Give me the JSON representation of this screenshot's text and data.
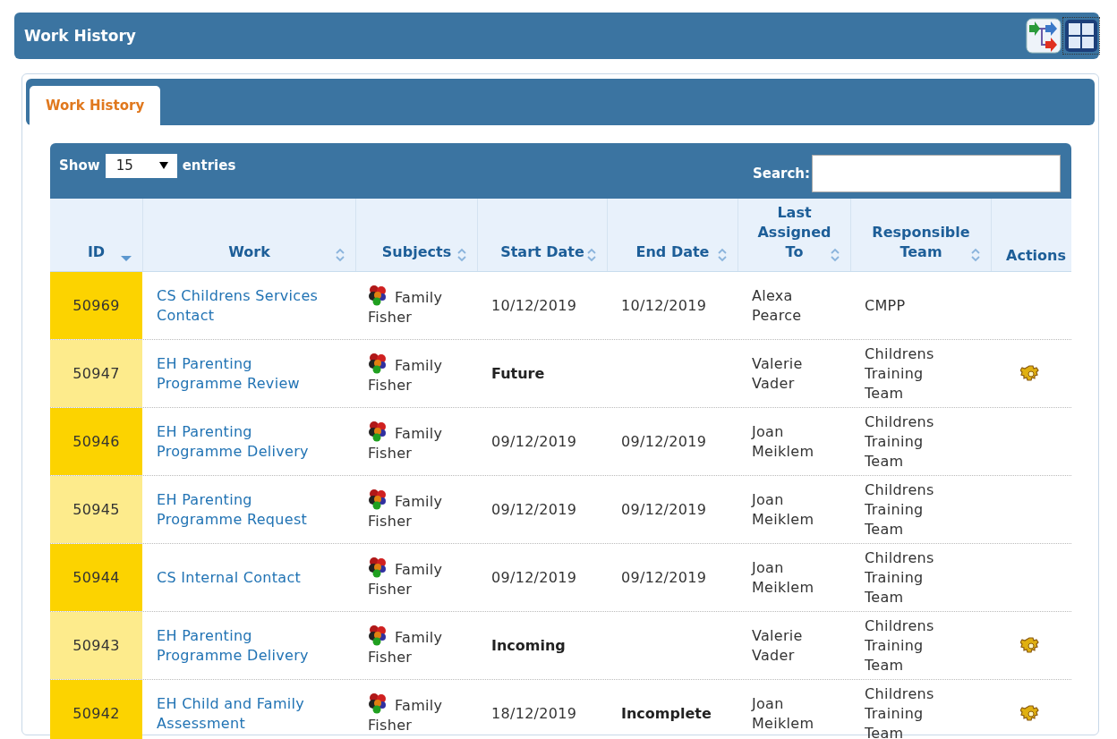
{
  "panel": {
    "title": "Work History"
  },
  "tabs": [
    {
      "label": "Work History",
      "selected": true
    }
  ],
  "table": {
    "length_label_before": "Show",
    "length_value": "15",
    "length_label_after": "entries",
    "search_label": "Search:",
    "columns": [
      {
        "label": "ID",
        "sortable": true,
        "sorted_descending": true
      },
      {
        "label": "Work",
        "sortable": true,
        "sorted_descending": false
      },
      {
        "label": "Subjects",
        "sortable": true,
        "sorted_descending": false
      },
      {
        "label": "Start Date",
        "sortable": true,
        "sorted_descending": false
      },
      {
        "label": "End Date",
        "sortable": true,
        "sorted_descending": false
      },
      {
        "label": "Last Assigned To",
        "sortable": true,
        "sorted_descending": false
      },
      {
        "label": "Responsible Team",
        "sortable": true,
        "sorted_descending": false
      },
      {
        "label": "Actions",
        "sortable": false
      }
    ],
    "rows": [
      {
        "id": "50969",
        "work": "CS Childrens Services Contact",
        "subject": "Family Fisher",
        "start": "10/12/2019",
        "start_bold": false,
        "end": "10/12/2019",
        "end_bold": false,
        "assigned": "Alexa Pearce",
        "team": "CMPP",
        "has_action": false
      },
      {
        "id": "50947",
        "work": "EH Parenting Programme Review",
        "subject": "Family Fisher",
        "start": "Future",
        "start_bold": true,
        "end_bold": false,
        "assigned": "Valerie Vader",
        "team": "Childrens Training Team",
        "has_action": true
      },
      {
        "id": "50946",
        "work": "EH Parenting Programme Delivery",
        "subject": "Family Fisher",
        "start": "09/12/2019",
        "start_bold": false,
        "end": "09/12/2019",
        "end_bold": false,
        "assigned": "Joan Meiklem",
        "team": "Childrens Training Team",
        "has_action": false
      },
      {
        "id": "50945",
        "work": "EH Parenting Programme Request",
        "subject": "Family Fisher",
        "start": "09/12/2019",
        "start_bold": false,
        "end": "09/12/2019",
        "end_bold": false,
        "assigned": "Joan Meiklem",
        "team": "Childrens Training Team",
        "has_action": false
      },
      {
        "id": "50944",
        "work": "CS Internal Contact",
        "subject": "Family Fisher",
        "start": "09/12/2019",
        "start_bold": false,
        "end": "09/12/2019",
        "end_bold": false,
        "assigned": "Joan Meiklem",
        "team": "Childrens Training Team",
        "has_action": false
      },
      {
        "id": "50943",
        "work": "EH Parenting Programme Delivery",
        "subject": "Family Fisher",
        "start": "Incoming",
        "start_bold": true,
        "end_bold": false,
        "assigned": "Valerie Vader",
        "team": "Childrens Training Team",
        "has_action": true
      },
      {
        "id": "50942",
        "work": "EH Child and Family Assessment",
        "subject": "Family Fisher",
        "start": "18/12/2019",
        "start_bold": false,
        "end": "Incomplete",
        "end_bold": true,
        "assigned": "Joan Meiklem",
        "team": "Childrens Training Team",
        "has_action": true
      }
    ]
  }
}
